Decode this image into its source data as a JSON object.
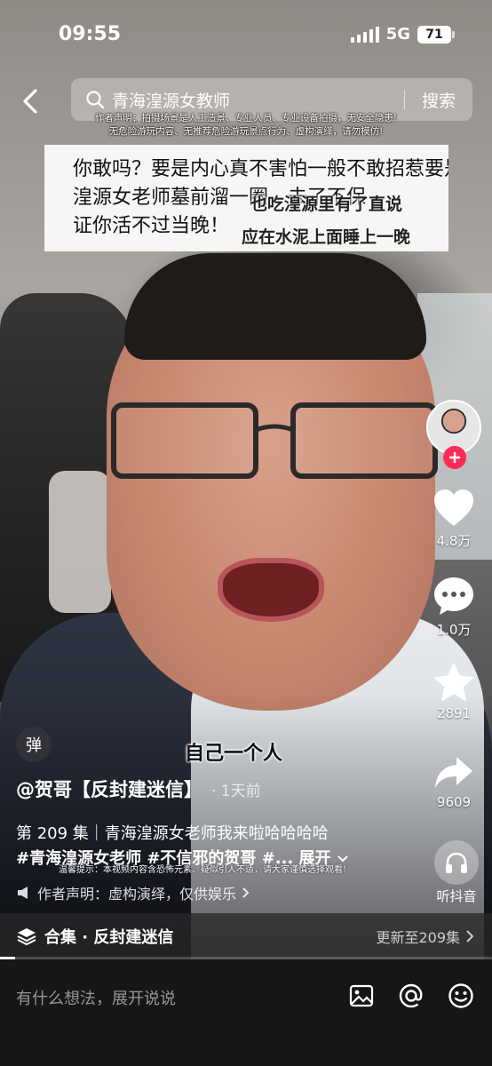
{
  "status_bar": {
    "time": "09:55",
    "network": "5G",
    "battery": "71"
  },
  "search": {
    "query": "青海湟源女教师",
    "button": "搜索"
  },
  "disclaimer": {
    "line1": "作者声明：拍摄场景是人工造景、专业人员、专业设备拍摄，无安全隐患!",
    "line2": "无危险游玩内容、无推荐危险游玩景点行为、虚构演绎，请勿模仿!"
  },
  "caption": {
    "line1": "你敢吗？要是内心真不害怕一般不敢招惹要是八字够",
    "line2": "湟源女老师墓前溜一圈，去了不保",
    "line3": "证你活不过当晚！",
    "overlay_a": "也吃湟源里有了直说",
    "overlay_b": "应在水泥上面睡上一晚"
  },
  "actions": {
    "likes": "4.8万",
    "comments": "1.0万",
    "favorites": "2891",
    "shares": "9609",
    "listen": "听抖音"
  },
  "video_overlay": {
    "subtitle": "自己一个人"
  },
  "danmu": "弹",
  "author": {
    "name": "@贺哥【反封建迷信】",
    "time": "· 1天前"
  },
  "description": {
    "line1": "第 209 集｜青海湟源女老师我来啦哈哈哈哈",
    "line2": "#青海湟源女老师 #不信邪的贺哥 #... 展开"
  },
  "warning_small": "温馨提示：本视频内容含恐怖元素、疑似引人不适，请大家谨慎选择观看!",
  "notice": {
    "text": "作者声明：虚构演绎，仅供娱乐"
  },
  "collection": {
    "label": "合集 · 反封建迷信",
    "update": "更新至209集"
  },
  "progress": {
    "fraction": 0.03
  },
  "comment": {
    "placeholder": "有什么想法，展开说说"
  }
}
